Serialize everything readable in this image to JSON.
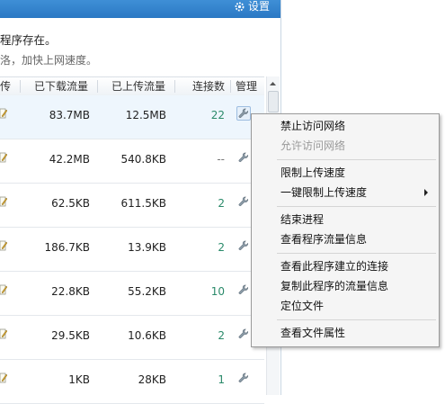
{
  "header": {
    "settings_label": "设置"
  },
  "notice": "程序存在。",
  "tip": "洛，加快上网速度。",
  "table": {
    "columns": [
      "传",
      "已下载流量",
      "已上传流量",
      "连接数",
      "管理"
    ],
    "rows": [
      {
        "downloaded": "83.7MB",
        "uploaded": "12.5MB",
        "connections": "22",
        "selected": true
      },
      {
        "downloaded": "42.2MB",
        "uploaded": "540.8KB",
        "connections": "--"
      },
      {
        "downloaded": "62.5KB",
        "uploaded": "611.5KB",
        "connections": "2"
      },
      {
        "downloaded": "186.7KB",
        "uploaded": "13.9KB",
        "connections": "2"
      },
      {
        "downloaded": "22.8KB",
        "uploaded": "55.2KB",
        "connections": "10"
      },
      {
        "downloaded": "29.5KB",
        "uploaded": "10.6KB",
        "connections": "2"
      },
      {
        "downloaded": "1KB",
        "uploaded": "28KB",
        "connections": "1"
      }
    ]
  },
  "context_menu": {
    "items": [
      {
        "label": "禁止访问网络",
        "enabled": true
      },
      {
        "label": "允许访问网络",
        "enabled": false
      },
      {
        "label": "限制上传速度",
        "enabled": true
      },
      {
        "label": "一键限制上传速度",
        "enabled": true,
        "submenu": true
      },
      {
        "label": "结束进程",
        "enabled": true
      },
      {
        "label": "查看程序流量信息",
        "enabled": true
      },
      {
        "label": "查看此程序建立的连接",
        "enabled": true
      },
      {
        "label": "复制此程序的流量信息",
        "enabled": true
      },
      {
        "label": "定位文件",
        "enabled": true
      },
      {
        "label": "查看文件属性",
        "enabled": true
      }
    ]
  },
  "colors": {
    "titlebar": "#2b78c4",
    "connections": "#2a8a6a",
    "selected_row": "#eef6fd"
  },
  "icons": {
    "settings": "gear-icon",
    "edit": "edit-icon",
    "manage": "wrench-icon"
  }
}
